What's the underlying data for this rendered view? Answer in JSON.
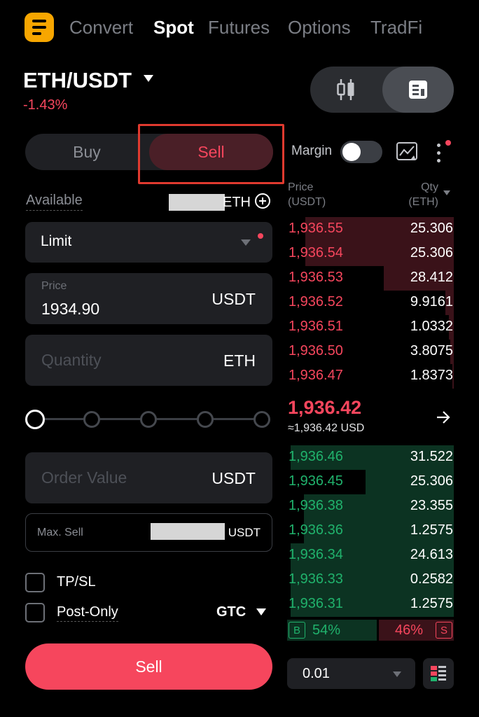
{
  "nav": {
    "tabs": [
      {
        "label": "Convert",
        "active": false
      },
      {
        "label": "Spot",
        "active": true
      },
      {
        "label": "Futures",
        "active": false
      },
      {
        "label": "Options",
        "active": false
      },
      {
        "label": "TradFi",
        "active": false
      }
    ],
    "menu_icon": "menu-lines-icon"
  },
  "pair": {
    "symbol": "ETH/USDT",
    "change": "-1.43%"
  },
  "view_toggle": {
    "options": [
      "candlestick-icon",
      "orderbook-icon"
    ],
    "selected": "orderbook-icon"
  },
  "order_side": {
    "buy_label": "Buy",
    "sell_label": "Sell",
    "selected": "Sell"
  },
  "available": {
    "label": "Available",
    "unit": "ETH"
  },
  "order_type": {
    "value": "Limit"
  },
  "price_field": {
    "label": "Price",
    "value": "1934.90",
    "unit": "USDT"
  },
  "quantity_field": {
    "placeholder": "Quantity",
    "unit": "ETH"
  },
  "slider": {
    "steps": 5,
    "value": 0
  },
  "order_value_field": {
    "placeholder": "Order Value",
    "unit": "USDT"
  },
  "max_sell": {
    "label": "Max. Sell",
    "unit": "USDT"
  },
  "options": {
    "tpsl_label": "TP/SL",
    "post_only_label": "Post-Only",
    "time_in_force": "GTC"
  },
  "submit": {
    "label": "Sell"
  },
  "toolbar": {
    "margin_label": "Margin",
    "margin_enabled": false
  },
  "orderbook": {
    "price_header": "Price",
    "price_unit": "(USDT)",
    "qty_header": "Qty",
    "qty_unit": "(ETH)",
    "asks": [
      {
        "price": "1,936.55",
        "qty": "25.306",
        "depth": 0.89
      },
      {
        "price": "1,936.54",
        "qty": "25.306",
        "depth": 0.89
      },
      {
        "price": "1,936.53",
        "qty": "28.412",
        "depth": 0.42
      },
      {
        "price": "1,936.52",
        "qty": "9.9161",
        "depth": 0.05
      },
      {
        "price": "1,936.51",
        "qty": "1.0332",
        "depth": 0.03
      },
      {
        "price": "1,936.50",
        "qty": "3.8075",
        "depth": 0.02
      },
      {
        "price": "1,936.47",
        "qty": "1.8373",
        "depth": 0.01
      }
    ],
    "mid_price": "1,936.42",
    "mid_usd": "≈1,936.42 USD",
    "bids": [
      {
        "price": "1,936.46",
        "qty": "31.522",
        "depth": 0.98
      },
      {
        "price": "1,936.45",
        "qty": "25.306",
        "depth": 0.53
      },
      {
        "price": "1,936.38",
        "qty": "23.355",
        "depth": 0.9
      },
      {
        "price": "1,936.36",
        "qty": "1.2575",
        "depth": 0.9
      },
      {
        "price": "1,936.34",
        "qty": "24.613",
        "depth": 0.98
      },
      {
        "price": "1,936.33",
        "qty": "0.2582",
        "depth": 0.98
      },
      {
        "price": "1,936.31",
        "qty": "1.2575",
        "depth": 0.98
      }
    ],
    "buy_badge": "B",
    "buy_ratio": "54%",
    "sell_ratio": "46%",
    "sell_badge": "S",
    "depth_step": "0.01"
  },
  "colors": {
    "accent": "#f7a600",
    "sell": "#f6465d",
    "buy": "#20b26c",
    "background": "#000000"
  }
}
